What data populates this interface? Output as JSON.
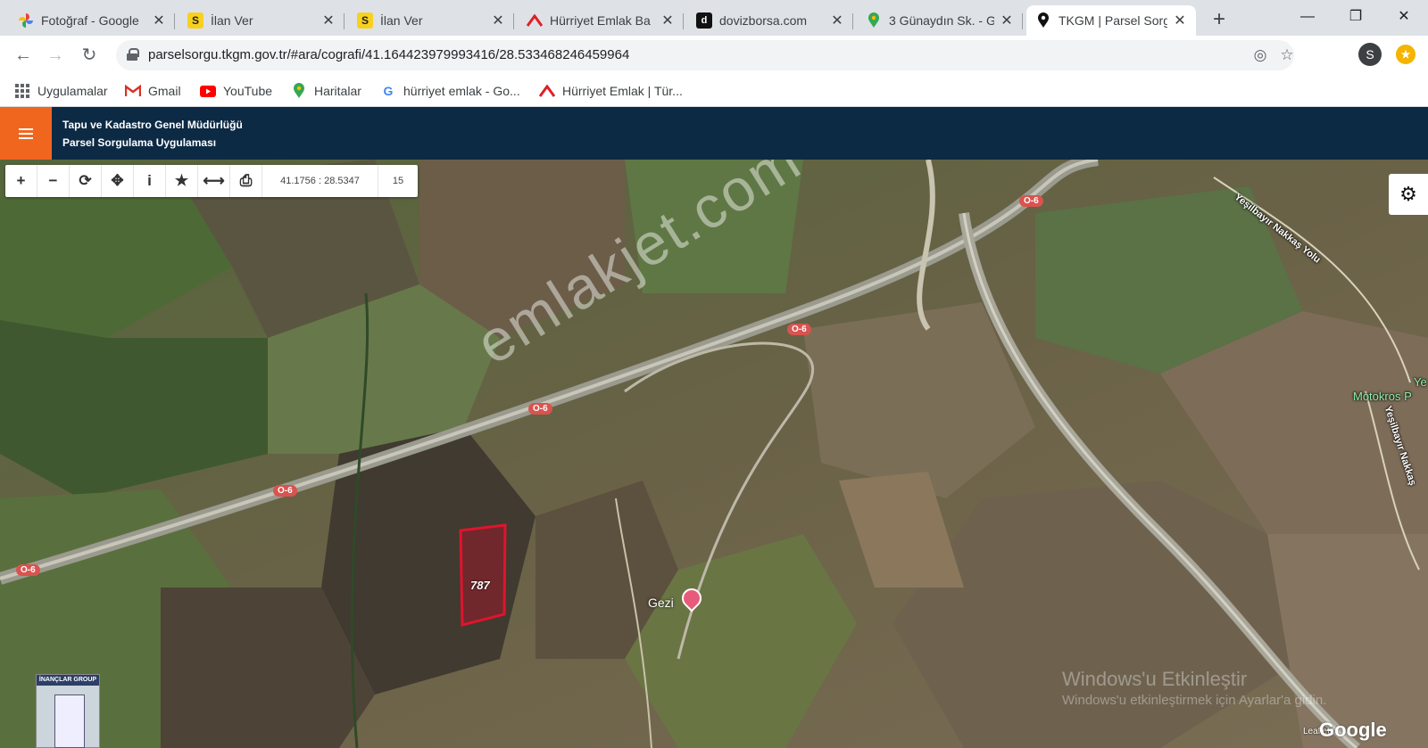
{
  "browser": {
    "tabs": [
      {
        "title": "Fotoğraf - Google",
        "favicon": "photos-icon",
        "active": false
      },
      {
        "title": "İlan Ver",
        "favicon": "S",
        "active": false
      },
      {
        "title": "İlan Ver",
        "favicon": "S",
        "active": false
      },
      {
        "title": "Hürriyet Emlak Ba",
        "favicon": "hurriyet-icon",
        "active": false
      },
      {
        "title": "dovizborsa.com",
        "favicon": "dovizborsa-icon",
        "active": false
      },
      {
        "title": "3 Günaydın Sk. - G",
        "favicon": "maps-pin-icon",
        "active": false
      },
      {
        "title": "TKGM | Parsel Sorg",
        "favicon": "location-pin-icon",
        "active": true
      }
    ],
    "new_tab_symbol": "+",
    "window_controls": {
      "minimize": "—",
      "maximize": "❐",
      "close": "✕"
    },
    "url": "parselsorgu.tkgm.gov.tr/#ara/cografi/41.164423979993416/28.533468246459964",
    "profile_initial": "S",
    "bookmarks": [
      {
        "label": "Uygulamalar",
        "icon": "apps-grid-icon"
      },
      {
        "label": "Gmail",
        "icon": "gmail-icon"
      },
      {
        "label": "YouTube",
        "icon": "youtube-icon"
      },
      {
        "label": "Haritalar",
        "icon": "maps-icon"
      },
      {
        "label": "hürriyet emlak - Go...",
        "icon": "google-icon"
      },
      {
        "label": "Hürriyet Emlak | Tür...",
        "icon": "hurriyet-icon"
      }
    ]
  },
  "app": {
    "title_line1": "Tapu ve Kadastro Genel Müdürlüğü",
    "title_line2": "Parsel Sorgulama Uygulaması",
    "accent_color": "#f1661f",
    "header_color": "#0d2a44"
  },
  "map": {
    "coordinates": "41.1756 : 28.5347",
    "zoom": "15",
    "tools": [
      "zoom-in-icon",
      "zoom-out-icon",
      "refresh-icon",
      "locate-icon",
      "info-icon",
      "star-icon",
      "measure-icon",
      "print-icon"
    ],
    "parcel_number": "787",
    "poi_label": "Gezi",
    "road_labels": [
      "O-6",
      "O-6",
      "O-6",
      "O-6",
      "O-6"
    ],
    "street_label_1": "Yeşilbayır Nakkaş Yolu",
    "street_label_2": "Yeşilbayır Nakkaş",
    "place_label": "Motokros P",
    "place_label_2": "Ye",
    "watermark": "emlakjet.com",
    "os_notice_title": "Windows'u Etkinleştir",
    "os_notice_body": "Windows'u etkinleştirmek için Ayarlar'a gidin.",
    "attribution": "Leaflet",
    "provider": "Google",
    "logo_caption": "İNANÇLAR GROUP"
  }
}
